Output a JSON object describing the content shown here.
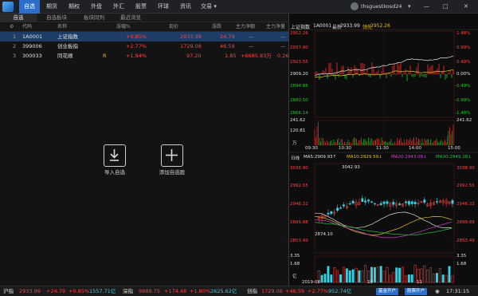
{
  "menubar": {
    "items": [
      "自选",
      "期货",
      "期权",
      "外盘",
      "外汇",
      "股票",
      "环球",
      "资讯",
      "交易 ▾"
    ],
    "username": "thsguestkosd24",
    "window_controls": [
      "—",
      "□",
      "✕"
    ]
  },
  "tabs": [
    "自选",
    "自选板块",
    "板块同列",
    "最近浏览"
  ],
  "table": {
    "headers": [
      "代码",
      "名称",
      "涨幅%",
      "现价",
      "涨跌",
      "主力净额",
      "主力净量"
    ],
    "rows": [
      {
        "index": "1",
        "code": "1A0001",
        "name": "上证指数",
        "flag": "",
        "change_pct": "+0.85%",
        "price": "2933.99",
        "change": "24.79",
        "net_amount": "—",
        "net_volume": "—"
      },
      {
        "index": "2",
        "code": "399006",
        "name": "创业板指",
        "flag": "",
        "change_pct": "+2.77%",
        "price": "1729.08",
        "change": "46.59",
        "net_amount": "—",
        "net_volume": "—"
      },
      {
        "index": "3",
        "code": "300033",
        "name": "同花顺",
        "flag": "R",
        "change_pct": "+1.94%",
        "price": "97.20",
        "change": "1.85",
        "net_amount": "+6685.83万",
        "net_volume": "0.26"
      }
    ]
  },
  "center_buttons": {
    "import_label": "导入自选",
    "add_label": "添加自选股"
  },
  "intraday": {
    "title": "上证指数",
    "code": "1A0001",
    "latest_label": "最新",
    "latest": "2933.99",
    "lead_label": "领先",
    "lead": "2952.26",
    "price_ticks": [
      "2952.26",
      "2937.90",
      "2923.55",
      "2909.20",
      "2894.86",
      "2880.50",
      "2866.14"
    ],
    "pct_ticks": [
      "1.48%",
      "0.99%",
      "0.49%",
      "0.00%",
      "-0.49%",
      "-0.99%",
      "-1.48%"
    ],
    "volume_ticks": [
      "241.62",
      "241.62",
      "120.81",
      "万"
    ],
    "time_ticks": [
      "09:30",
      "10:30",
      "11:30",
      "14:00",
      "15:00"
    ]
  },
  "kline": {
    "period_label": "日线",
    "ma5": "MA5:2909.93↑",
    "ma10": "MA10:2929.59↓",
    "ma20": "MA20:2943.06↓",
    "ma30": "MA30:2949.28↓",
    "high_mark": "3042.93",
    "low_mark": "2874.10",
    "price_ticks": [
      "3038.90",
      "2992.55",
      "2946.22",
      "2899.88",
      "2853.49"
    ],
    "volume_ticks": [
      "3.35",
      "1.68",
      "亿"
    ],
    "date_ticks": [
      "2019-08",
      "10",
      "11"
    ],
    "colors": {
      "ma5": "#e0e0e0",
      "ma10": "#e8c020",
      "ma20": "#d040d0",
      "ma30": "#20c040"
    }
  },
  "statusbar": {
    "sh_label": "沪指",
    "sh_price": "2933.99",
    "sh_change": "+24.79",
    "sh_pct": "+0.85%",
    "sh_amount": "1557.71亿",
    "sz_label": "深指",
    "sz_price": "9889.75",
    "sz_change": "+174.48",
    "sz_pct": "+1.80%",
    "sz_amount": "2625.62亿",
    "cy_label": "创指",
    "cy_price": "1729.08",
    "cy_change": "+46.59",
    "cy_pct": "+2.77%",
    "cy_amount": "952.74亿",
    "btn1": "基金开户",
    "btn2": "股票开户",
    "time": "17:31:15"
  },
  "colors": {
    "up": "#ff4141",
    "down": "#1ec81e",
    "accent": "#2c6ec8"
  }
}
